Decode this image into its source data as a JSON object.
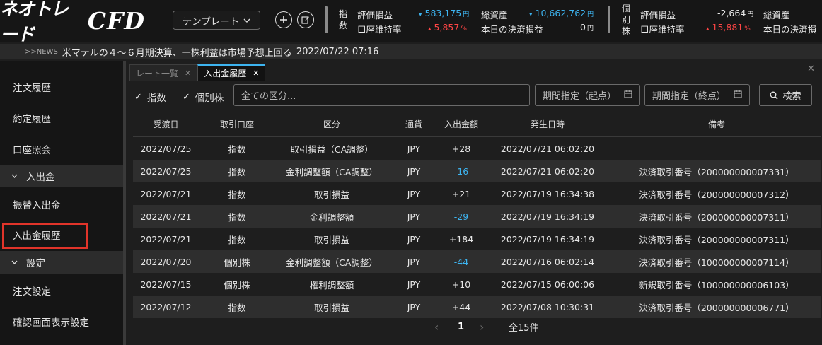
{
  "header": {
    "logo_jp": "ネオトレード",
    "logo_cfd": "CFD",
    "template_label": "テンプレート",
    "index": {
      "vertical_label": [
        "指",
        "数"
      ],
      "eval_label": "評価損益",
      "eval_value": "583,175",
      "eval_unit": "円",
      "margin_label": "口座維持率",
      "margin_value": "5,857",
      "margin_unit": "%",
      "total_label": "総資産",
      "total_value": "10,662,762",
      "total_unit": "円",
      "settle_label": "本日の決済損益",
      "settle_value": "0",
      "settle_unit": "円"
    },
    "stock": {
      "vertical_label": [
        "個",
        "別",
        "株"
      ],
      "eval_label": "評価損益",
      "eval_value": "-2,664",
      "eval_unit": "円",
      "margin_label": "口座維持率",
      "margin_value": "15,881",
      "margin_unit": "%",
      "total_label": "総資産",
      "settle_label": "本日の決済損"
    }
  },
  "news": {
    "label": ">>NEWS",
    "text": "米マテルの４～６月期決算、一株利益は市場予想上回る",
    "datetime": "2022/07/22 07:16"
  },
  "sidebar": {
    "items": [
      {
        "label": "注文履歴"
      },
      {
        "label": "約定履歴"
      },
      {
        "label": "口座照会"
      },
      {
        "label": "入出金"
      },
      {
        "label": "振替入出金"
      },
      {
        "label": "入出金履歴"
      },
      {
        "label": "設定"
      },
      {
        "label": "注文設定"
      },
      {
        "label": "確認画面表示設定"
      }
    ]
  },
  "tabs": [
    {
      "label": "レート一覧",
      "active": false
    },
    {
      "label": "入出金履歴",
      "active": true
    }
  ],
  "filter": {
    "check_index": "指数",
    "check_stock": "個別株",
    "category_placeholder": "全ての区分...",
    "period_start": "期間指定（起点）",
    "period_end": "期間指定（終点）",
    "search_label": "検索"
  },
  "table": {
    "columns": [
      "受渡日",
      "取引口座",
      "区分",
      "通貨",
      "入出金額",
      "発生日時",
      "備考"
    ],
    "rows": [
      [
        "2022/07/25",
        "指数",
        "取引損益（CA調整）",
        "JPY",
        "+28",
        "2022/07/21 06:02:20",
        ""
      ],
      [
        "2022/07/25",
        "指数",
        "金利調整額（CA調整）",
        "JPY",
        "-16",
        "2022/07/21 06:02:20",
        "決済取引番号（200000000007331）"
      ],
      [
        "2022/07/21",
        "指数",
        "取引損益",
        "JPY",
        "+21",
        "2022/07/19 16:34:38",
        "決済取引番号（200000000007312）"
      ],
      [
        "2022/07/21",
        "指数",
        "金利調整額",
        "JPY",
        "-29",
        "2022/07/19 16:34:19",
        "決済取引番号（200000000007311）"
      ],
      [
        "2022/07/21",
        "指数",
        "取引損益",
        "JPY",
        "+184",
        "2022/07/19 16:34:19",
        "決済取引番号（200000000007311）"
      ],
      [
        "2022/07/20",
        "個別株",
        "金利調整額（CA調整）",
        "JPY",
        "-44",
        "2022/07/16 06:02:14",
        "決済取引番号（100000000007114）"
      ],
      [
        "2022/07/15",
        "個別株",
        "権利調整額",
        "JPY",
        "+10",
        "2022/07/15 06:00:06",
        "新規取引番号（100000000006103）"
      ],
      [
        "2022/07/12",
        "指数",
        "取引損益",
        "JPY",
        "+44",
        "2022/07/08 10:30:31",
        "決済取引番号（200000000006771）"
      ]
    ]
  },
  "pager": {
    "current": "1",
    "total": "全15件"
  },
  "colors": {
    "accent_blue": "#3db4f0",
    "negative_red": "#ff4545",
    "highlight_box": "#e1342a"
  }
}
